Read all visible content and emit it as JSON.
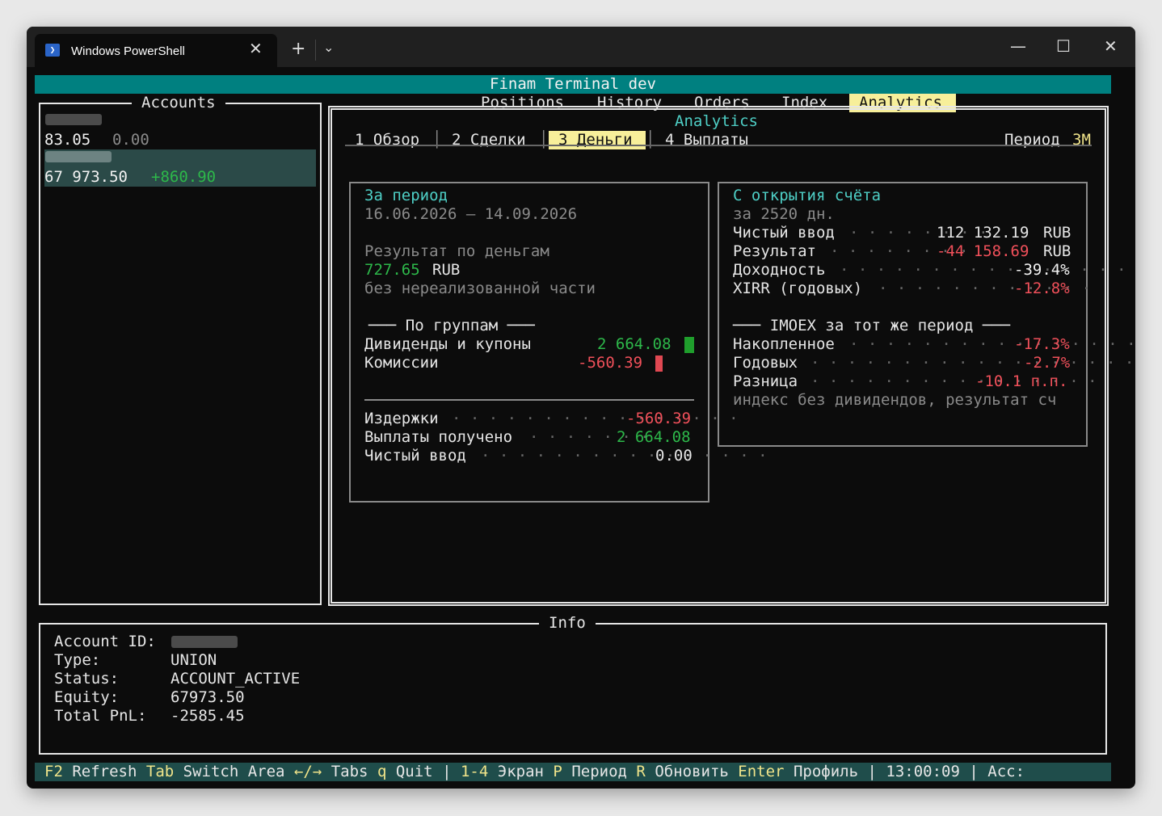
{
  "window": {
    "tab_title": "Windows PowerShell",
    "icon": "powershell-icon",
    "buttons": {
      "close_tab": "✕",
      "new_tab": "+",
      "dropdown": "⌄",
      "minimize": "—",
      "maximize": "☐",
      "close": "✕"
    }
  },
  "app": {
    "title": "Finam Terminal dev"
  },
  "nav_tabs": [
    "Positions",
    "History",
    "Orders",
    "Index",
    "Analytics"
  ],
  "active_nav": "Analytics",
  "accounts": {
    "title": "Accounts",
    "items": [
      {
        "balance": "83.05",
        "pnl": "0.00"
      },
      {
        "balance": "67 973.50",
        "pnl": "+860.90"
      }
    ]
  },
  "analytics": {
    "title": "Analytics",
    "subtabs": [
      "1 Обзор",
      "2 Сделки",
      "3 Деньги",
      "4 Выплаты"
    ],
    "active_subtab": "3 Деньги",
    "period_label": "Период",
    "period_value": "3M",
    "for_period": {
      "title": "За период",
      "dates": "16.06.2026 – 14.09.2026",
      "result_label": "Результат по деньгам",
      "result_value": "727.65",
      "result_currency": "RUB",
      "note": "без нереализованной части",
      "groups_title": "─── По группам ───",
      "groups": [
        {
          "label": "Дивиденды и купоны",
          "value": "2 664.08"
        },
        {
          "label": "Комиссии",
          "value": "-560.39"
        }
      ],
      "summary": [
        {
          "label": "Издержки",
          "value": "-560.39"
        },
        {
          "label": "Выплаты получено",
          "value": "2 664.08"
        },
        {
          "label": "Чистый ввод",
          "value": "0.00"
        }
      ]
    },
    "since_open": {
      "title": "С открытия счёта",
      "days": "за 2520 дн.",
      "rows": [
        {
          "label": "Чистый ввод",
          "value": "112 132.19",
          "unit": "RUB"
        },
        {
          "label": "Результат",
          "value": "-44 158.69",
          "unit": "RUB"
        },
        {
          "label": "Доходность",
          "value": "-39.4%",
          "unit": ""
        },
        {
          "label": "XIRR (годовых)",
          "value": "-12.8%",
          "unit": ""
        }
      ],
      "imoex_title": "─── IMOEX за тот же период ───",
      "imoex_rows": [
        {
          "label": "Накопленное",
          "value": "-17.3%"
        },
        {
          "label": "Годовых",
          "value": "-2.7%"
        },
        {
          "label": "Разница",
          "value": "-10.1 п.п."
        }
      ],
      "imoex_note": "индекс без дивидендов, результат сч"
    }
  },
  "info": {
    "title": "Info",
    "rows": [
      {
        "label": "Account ID:",
        "value": ""
      },
      {
        "label": "Type:",
        "value": "UNION"
      },
      {
        "label": "Status:",
        "value": "ACCOUNT_ACTIVE"
      },
      {
        "label": "Equity:",
        "value": "67973.50"
      },
      {
        "label": "Total PnL:",
        "value": "-2585.45"
      }
    ]
  },
  "statusbar": [
    {
      "key": "F2",
      "text": "Refresh"
    },
    {
      "key": "Tab",
      "text": "Switch Area"
    },
    {
      "key": "←/→",
      "text": "Tabs"
    },
    {
      "key": "q",
      "text": "Quit"
    },
    {
      "sep": "|"
    },
    {
      "key": "1-4",
      "text": "Экран"
    },
    {
      "key": "P",
      "text": "Период"
    },
    {
      "key": "R",
      "text": "Обновить"
    },
    {
      "key": "Enter",
      "text": "Профиль"
    },
    {
      "sep": "|"
    },
    {
      "text": "13:00:09"
    },
    {
      "sep": "|"
    },
    {
      "text": "Acc:"
    }
  ],
  "colors": {
    "header_bg": "#008080",
    "accent_cyan": "#4ecfc6",
    "positive": "#2db84a",
    "negative": "#f0505a",
    "highlight": "#f7ef9a",
    "selected_row": "#2b4a48"
  }
}
